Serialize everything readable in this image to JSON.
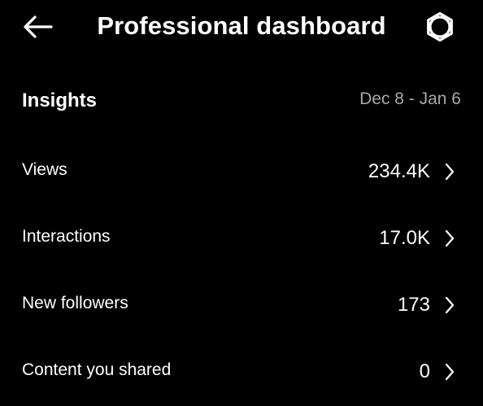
{
  "header": {
    "back_icon": "arrow-left-icon",
    "title": "Professional dashboard",
    "settings_icon": "gear-icon"
  },
  "insights": {
    "heading": "Insights",
    "date_range": "Dec 8 - Jan 6"
  },
  "metrics": [
    {
      "label": "Views",
      "value": "234.4K"
    },
    {
      "label": "Interactions",
      "value": "17.0K"
    },
    {
      "label": "New followers",
      "value": "173"
    },
    {
      "label": "Content you shared",
      "value": "0"
    }
  ],
  "colors": {
    "background": "#000000",
    "text_primary": "#ffffff",
    "text_secondary": "#a8a8a8"
  }
}
